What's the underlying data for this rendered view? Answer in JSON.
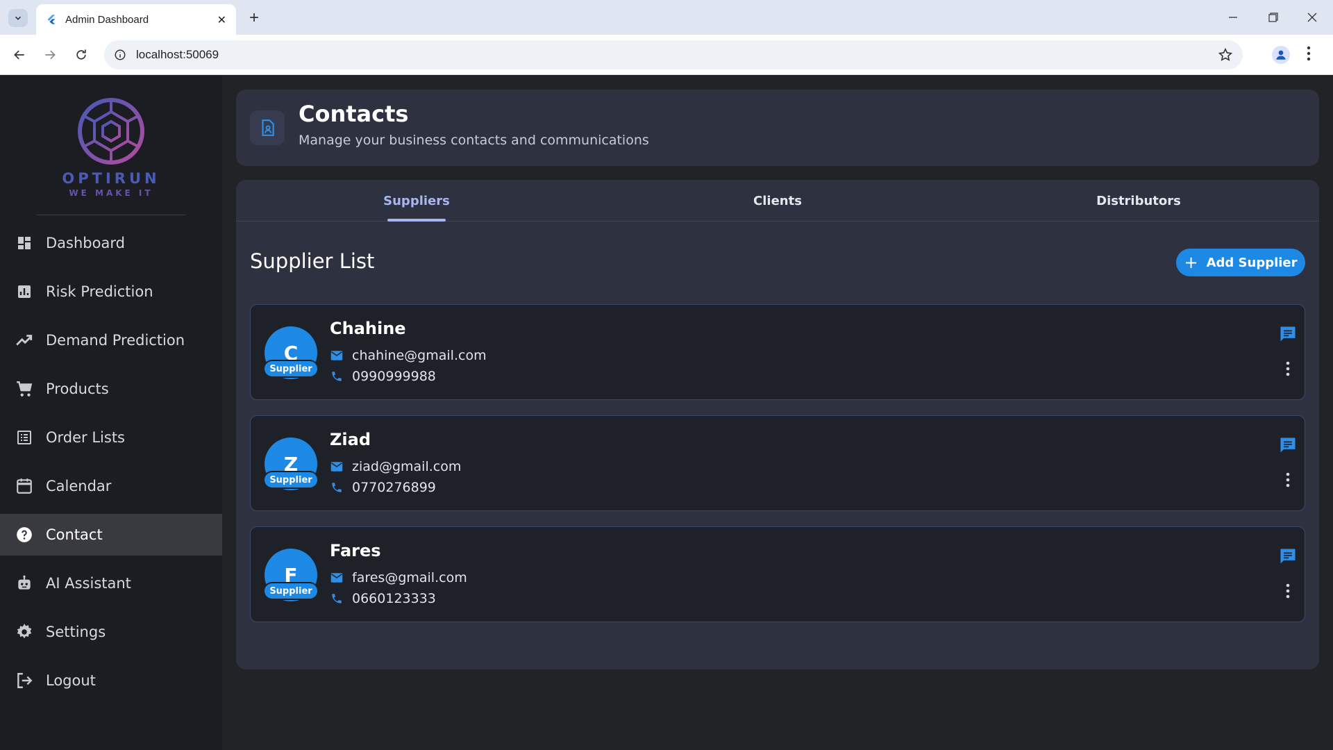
{
  "browser": {
    "tab_title": "Admin Dashboard",
    "url": "localhost:50069"
  },
  "sidebar": {
    "brand": "OPTIRUN",
    "tagline": "WE MAKE IT",
    "items": [
      {
        "label": "Dashboard",
        "icon": "dashboard-icon"
      },
      {
        "label": "Risk Prediction",
        "icon": "bar-chart-icon"
      },
      {
        "label": "Demand Prediction",
        "icon": "trending-up-icon"
      },
      {
        "label": "Products",
        "icon": "cart-icon"
      },
      {
        "label": "Order Lists",
        "icon": "list-icon"
      },
      {
        "label": "Calendar",
        "icon": "calendar-icon"
      },
      {
        "label": "Contact",
        "icon": "help-icon",
        "active": true
      },
      {
        "label": "AI Assistant",
        "icon": "robot-icon"
      },
      {
        "label": "Settings",
        "icon": "gear-icon"
      },
      {
        "label": "Logout",
        "icon": "logout-icon"
      }
    ]
  },
  "header": {
    "title": "Contacts",
    "subtitle": "Manage your business contacts and communications"
  },
  "tabs": [
    {
      "label": "Suppliers",
      "active": true
    },
    {
      "label": "Clients"
    },
    {
      "label": "Distributors"
    }
  ],
  "list": {
    "title": "Supplier List",
    "add_label": "Add Supplier",
    "badge_label": "Supplier",
    "contacts": [
      {
        "initial": "C",
        "name": "Chahine",
        "email": "chahine@gmail.com",
        "phone": "0990999988"
      },
      {
        "initial": "Z",
        "name": "Ziad",
        "email": "ziad@gmail.com",
        "phone": "0770276899"
      },
      {
        "initial": "F",
        "name": "Fares",
        "email": "fares@gmail.com",
        "phone": "0660123333"
      }
    ]
  },
  "colors": {
    "accent": "#1e88e5",
    "tab_active": "#a9b6f0",
    "sidebar_bg": "#1c1d22",
    "panel_bg": "#2d3140"
  }
}
